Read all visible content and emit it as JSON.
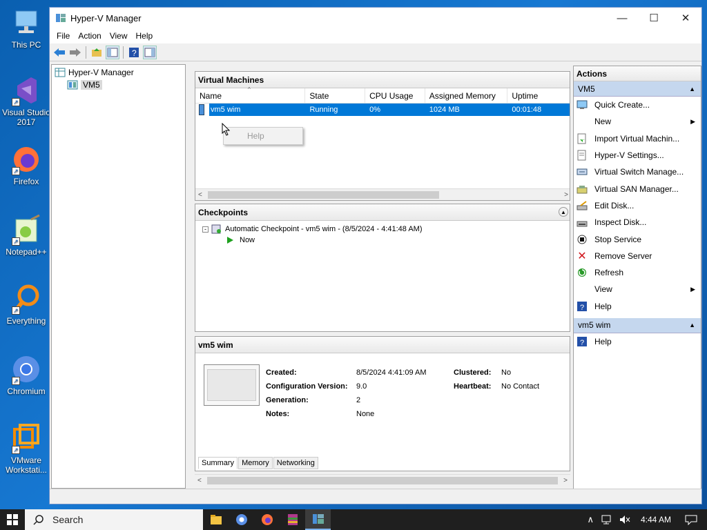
{
  "desktop": {
    "icons": [
      {
        "label": "This PC"
      },
      {
        "label": "Visual Studio 2017"
      },
      {
        "label": "Firefox"
      },
      {
        "label": "Notepad++"
      },
      {
        "label": "Everything"
      },
      {
        "label": "Chromium"
      },
      {
        "label": "VMware Workstati..."
      }
    ]
  },
  "window": {
    "title": "Hyper-V Manager",
    "controls": {
      "minimize": "—",
      "maximize": "☐",
      "close": "✕"
    }
  },
  "menu": [
    "File",
    "Action",
    "View",
    "Help"
  ],
  "tree": {
    "root": "Hyper-V Manager",
    "node": "VM5"
  },
  "vms": {
    "title": "Virtual Machines",
    "columns": [
      "Name",
      "State",
      "CPU Usage",
      "Assigned Memory",
      "Uptime"
    ],
    "rows": [
      {
        "name": "vm5 wim",
        "state": "Running",
        "cpu": "0%",
        "memory": "1024 MB",
        "uptime": "00:01:48"
      }
    ],
    "context_menu": "Help"
  },
  "checkpoints": {
    "title": "Checkpoints",
    "item": "Automatic Checkpoint - vm5 wim - (8/5/2024 - 4:41:48 AM)",
    "now": "Now"
  },
  "details": {
    "title": "vm5 wim",
    "created_label": "Created:",
    "created": "8/5/2024 4:41:09 AM",
    "config_label": "Configuration Version:",
    "config": "9.0",
    "generation_label": "Generation:",
    "generation": "2",
    "notes_label": "Notes:",
    "notes": "None",
    "clustered_label": "Clustered:",
    "clustered": "No",
    "heartbeat_label": "Heartbeat:",
    "heartbeat": "No Contact",
    "tabs": [
      "Summary",
      "Memory",
      "Networking"
    ]
  },
  "actions": {
    "title": "Actions",
    "group1": "VM5",
    "items1": [
      "Quick Create...",
      "New",
      "Import Virtual Machin...",
      "Hyper-V Settings...",
      "Virtual Switch Manage...",
      "Virtual SAN Manager...",
      "Edit Disk...",
      "Inspect Disk...",
      "Stop Service",
      "Remove Server",
      "Refresh",
      "View",
      "Help"
    ],
    "group2": "vm5 wim",
    "items2": [
      "Help"
    ]
  },
  "taskbar": {
    "search": "Search",
    "time": "4:44 AM"
  },
  "colors": {
    "selection": "#0078d7",
    "action_group": "#c5d7ee",
    "desktop": "#1778d2"
  }
}
